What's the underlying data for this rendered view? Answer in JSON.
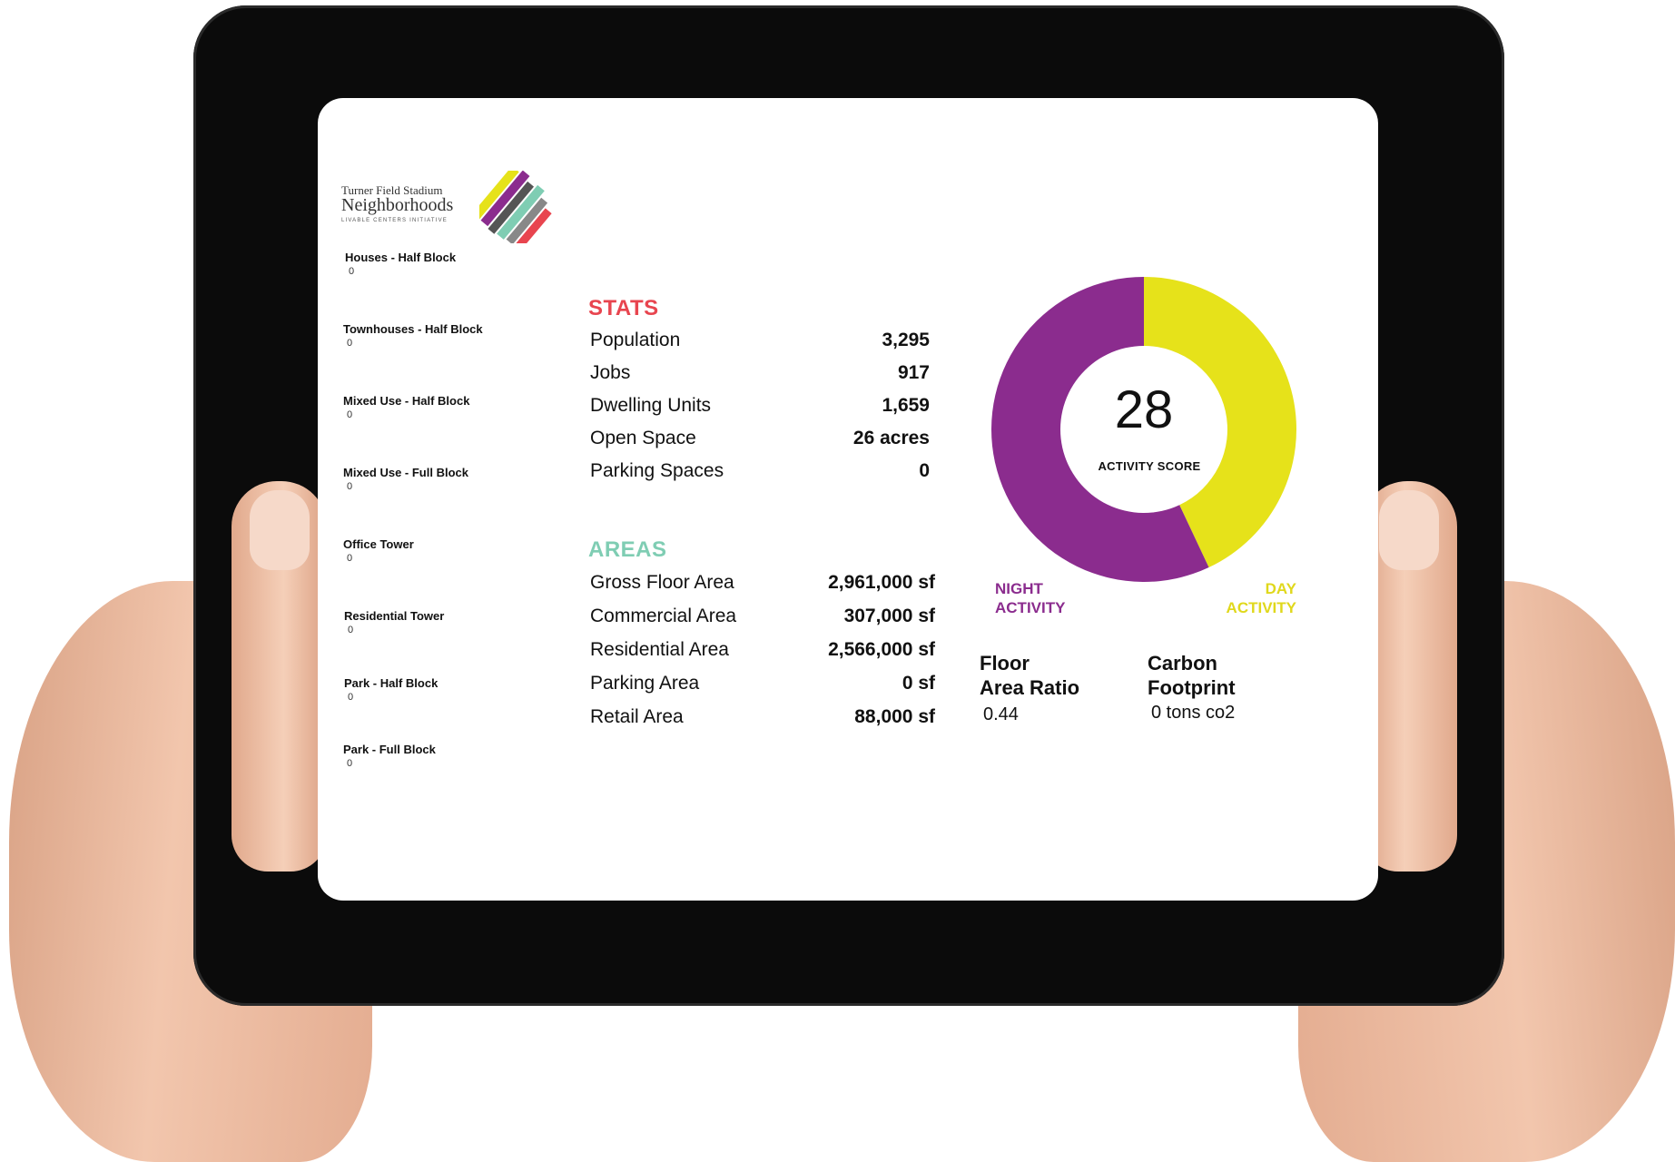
{
  "logo": {
    "line1": "Turner Field Stadium",
    "line2": "Neighborhoods",
    "line3": "LIVABLE CENTERS INITIATIVE"
  },
  "blocks": [
    {
      "label": "Houses - Half Block",
      "value": "0"
    },
    {
      "label": "Townhouses - Half Block",
      "value": "0"
    },
    {
      "label": "Mixed Use - Half Block",
      "value": "0"
    },
    {
      "label": "Mixed Use - Full Block",
      "value": "0"
    },
    {
      "label": "Office Tower",
      "value": "0"
    },
    {
      "label": "Residential Tower",
      "value": "0"
    },
    {
      "label": "Park - Half Block",
      "value": "0"
    },
    {
      "label": "Park - Full Block",
      "value": "0"
    }
  ],
  "stats": {
    "title": "STATS",
    "rows": [
      {
        "label": "Population",
        "value": "3,295"
      },
      {
        "label": "Jobs",
        "value": "917"
      },
      {
        "label": "Dwelling Units",
        "value": "1,659"
      },
      {
        "label": "Open Space",
        "value": "26 acres"
      },
      {
        "label": "Parking Spaces",
        "value": "0"
      }
    ]
  },
  "areas": {
    "title": "AREAS",
    "rows": [
      {
        "label": "Gross Floor Area",
        "value": "2,961,000 sf"
      },
      {
        "label": "Commercial Area",
        "value": "307,000 sf"
      },
      {
        "label": "Residential Area",
        "value": "2,566,000 sf"
      },
      {
        "label": "Parking Area",
        "value": "0 sf"
      },
      {
        "label": "Retail Area",
        "value": "88,000 sf"
      }
    ]
  },
  "activity": {
    "score": "28",
    "score_label": "ACTIVITY SCORE",
    "night_label_1": "NIGHT",
    "night_label_2": "ACTIVITY",
    "day_label_1": "DAY",
    "day_label_2": "ACTIVITY",
    "night_share": 0.57,
    "day_share": 0.43
  },
  "metrics": {
    "far_title_1": "Floor",
    "far_title_2": "Area Ratio",
    "far_value": "0.44",
    "carbon_title_1": "Carbon",
    "carbon_title_2": "Footprint",
    "carbon_value": "0 tons co2"
  },
  "colors": {
    "stats_title": "#e8454f",
    "areas_title": "#7fcdb3",
    "night": "#8b2c8e",
    "day": "#e6e21a"
  }
}
